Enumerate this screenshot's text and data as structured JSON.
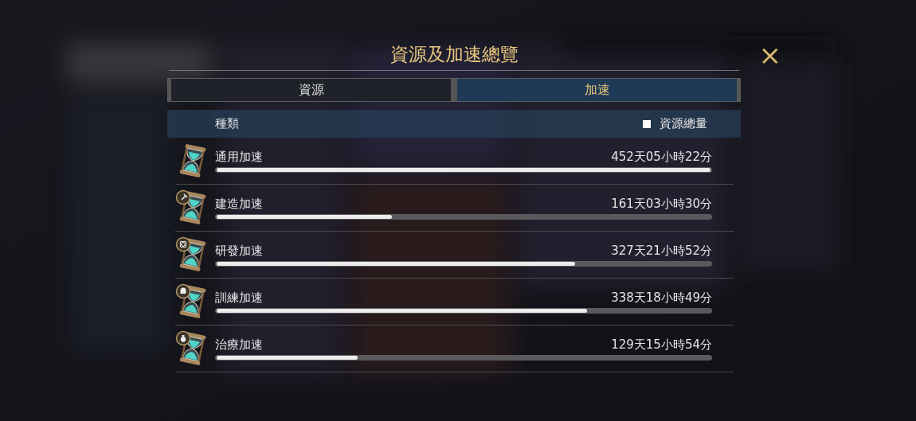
{
  "dialog": {
    "title": "資源及加速總覽",
    "close": "×"
  },
  "tabs": [
    {
      "label": "資源",
      "selected": false
    },
    {
      "label": "加速",
      "selected": true
    }
  ],
  "table": {
    "column_1": "種類",
    "legend": "資源總量"
  },
  "rows": [
    {
      "kind": "general",
      "name": "通用加速",
      "level": 1.0,
      "amount": "452天05小時22分"
    },
    {
      "kind": "build",
      "name": "建造加速",
      "level": 0.355,
      "amount": "161天03小時30分"
    },
    {
      "kind": "research",
      "name": "研發加速",
      "level": 0.725,
      "amount": "327天21小時52分"
    },
    {
      "kind": "train",
      "name": "訓練加速",
      "level": 0.75,
      "amount": "338天18小時49分"
    },
    {
      "kind": "heal",
      "name": "治療加速",
      "level": 0.286,
      "amount": "129天15小時54分"
    }
  ]
}
